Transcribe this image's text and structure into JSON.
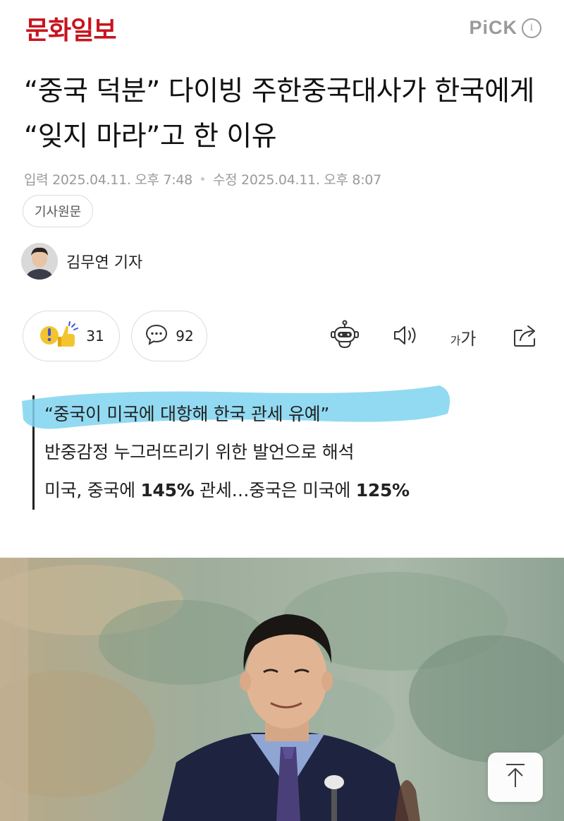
{
  "header": {
    "logo": "문화일보",
    "pick_label": "PiCK",
    "info_icon": "info-icon"
  },
  "article": {
    "headline": "“중국 덕분” 다이빙 주한중국대사가 한국에게 “잊지 마라”고 한 이유",
    "published": "입력 2025.04.11. 오후 7:48",
    "modified": "수정 2025.04.11. 오후 8:07",
    "original_button": "기사원문",
    "reporter": "김무연 기자"
  },
  "toolbar": {
    "reaction_count": "31",
    "comment_count": "92",
    "font_small": "가",
    "font_large": "가",
    "icons": [
      "reaction-icon",
      "comment-icon",
      "ai-summary-bot-icon",
      "audio-speaker-icon",
      "font-size-icon",
      "share-icon"
    ]
  },
  "summary": {
    "line1": "“중국이 미국에 대항해 한국 관세 유예”",
    "line2": "반중감정 누그러뜨리기 위한 발언으로 해석",
    "line3_prefix": "미국, 중국에 ",
    "line3_bold1": "145%",
    "line3_mid": " 관세…중국은 미국에 ",
    "line3_bold2": "125%",
    "highlight_color": "#7fd3f0"
  },
  "colors": {
    "brand": "#c8141e",
    "meta_text": "#9a9a9a"
  }
}
